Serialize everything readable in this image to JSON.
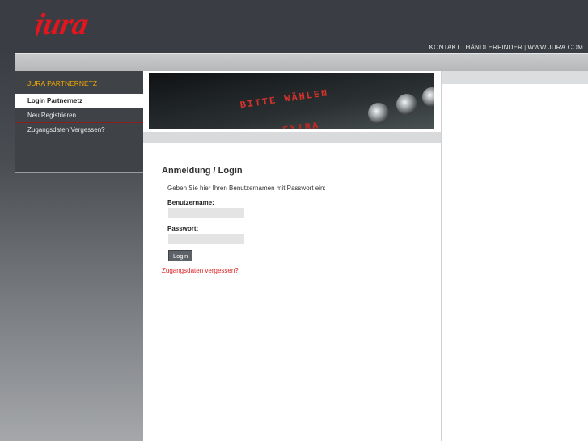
{
  "brand": {
    "logo_text": "jura",
    "accent": "#e3151e"
  },
  "toplinks": {
    "kontakt": "KONTAKT",
    "haendlerfinder": "HÄNDLERFINDER",
    "website": "WWW.JURA.COM",
    "separator": "|"
  },
  "sidebar": {
    "heading": "JURA PARTNERNETZ",
    "items": [
      {
        "label": "Login Partnernetz",
        "active": true
      },
      {
        "label": "Neu Registrieren",
        "active": false
      },
      {
        "label": "Zugangsdaten Vergessen?",
        "active": false
      }
    ]
  },
  "banner": {
    "display_text_1": "BITTE WÄHLEN",
    "display_text_2": "EXTRA"
  },
  "login": {
    "title": "Anmeldung / Login",
    "intro": "Geben Sie hier Ihren Benutzernamen mit Passwort ein:",
    "username_label": "Benutzername:",
    "username_value": "",
    "password_label": "Passwort:",
    "password_value": "",
    "submit_label": "Login",
    "forgot_link": "Zugangsdaten vergessen?"
  }
}
